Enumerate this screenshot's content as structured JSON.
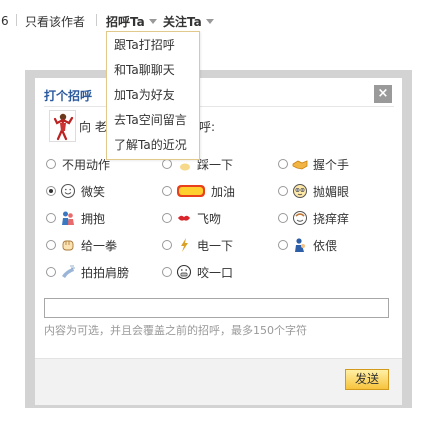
{
  "topbar": {
    "fragment": "6",
    "only_author": "只看该作者",
    "greet_menu": "招呼Ta",
    "follow": "关注Ta"
  },
  "dropdown": {
    "items": [
      "跟Ta打招呼",
      "和Ta聊聊天",
      "加Ta为好友",
      "去Ta空间留言",
      "了解Ta的近况"
    ]
  },
  "dialog": {
    "title": "打个招呼",
    "close": "×",
    "greeting_prefix": "向 老",
    "greeting_suffix": "呼:",
    "options": [
      {
        "label": "不用动作",
        "icon": "none-icon",
        "selected": false
      },
      {
        "label": "踩一下",
        "icon": "stomp-icon",
        "selected": false
      },
      {
        "label": "握个手",
        "icon": "handshake-icon",
        "selected": false
      },
      {
        "label": "微笑",
        "icon": "smile-icon",
        "selected": true
      },
      {
        "label": "加油",
        "icon": "cheer-icon",
        "selected": false
      },
      {
        "label": "抛媚眼",
        "icon": "wink-icon",
        "selected": false
      },
      {
        "label": "拥抱",
        "icon": "hug-icon",
        "selected": false
      },
      {
        "label": "飞吻",
        "icon": "kiss-icon",
        "selected": false
      },
      {
        "label": "挠痒痒",
        "icon": "tickle-icon",
        "selected": false
      },
      {
        "label": "给一拳",
        "icon": "punch-icon",
        "selected": false
      },
      {
        "label": "电一下",
        "icon": "zap-icon",
        "selected": false
      },
      {
        "label": "依偎",
        "icon": "cuddle-icon",
        "selected": false
      },
      {
        "label": "拍拍肩膀",
        "icon": "pat-icon",
        "selected": false
      },
      {
        "label": "咬一口",
        "icon": "bite-icon",
        "selected": false
      }
    ],
    "message_value": "",
    "hint": "内容为可选，并且会覆盖之前的招呼，最多150个字符",
    "send": "发送"
  },
  "colors": {
    "title": "#2b5a9e",
    "frame": "#d3d3d3",
    "dropdown_border": "#e1c98c",
    "send_button": "#f7c33c"
  }
}
